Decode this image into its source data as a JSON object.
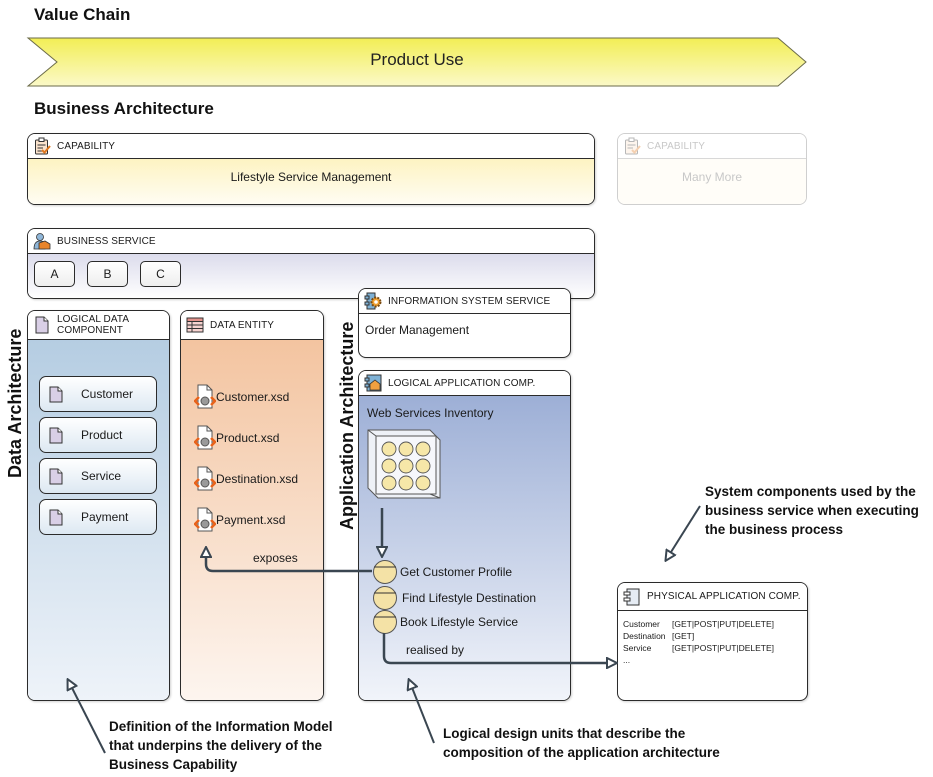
{
  "value_chain": {
    "title": "Value Chain",
    "stage_label": "Product Use"
  },
  "business_architecture": {
    "title": "Business Architecture",
    "capability": {
      "header": "CAPABILITY",
      "icon": "clipboard-check-icon",
      "name": "Lifestyle Service Management"
    },
    "capability_more": {
      "header": "CAPABILITY",
      "icon": "clipboard-check-icon",
      "name": "Many More"
    },
    "business_service": {
      "header": "BUSINESS SERVICE",
      "icon": "person-service-icon",
      "items": [
        "A",
        "B",
        "C"
      ]
    }
  },
  "data_architecture": {
    "title": "Data Architecture",
    "logical_data_component": {
      "header_line1": "LOGICAL DATA",
      "header_line2": "COMPONENT",
      "icon": "document-icon",
      "entities": [
        "Customer",
        "Product",
        "Service",
        "Payment"
      ]
    },
    "data_entity": {
      "header": "DATA ENTITY",
      "icon": "table-icon",
      "files": [
        "Customer.xsd",
        "Product.xsd",
        "Destination.xsd",
        "Payment.xsd"
      ],
      "file_icon": "xml-schema-icon"
    }
  },
  "application_architecture": {
    "title": "Application Architecture",
    "information_system_service": {
      "header": "INFORMATION SYSTEM SERVICE",
      "icon": "component-gear-icon",
      "name": "Order Management"
    },
    "logical_application_component": {
      "header": "LOGICAL APPLICATION COMP.",
      "icon": "component-app-icon",
      "name": "Web Services Inventory",
      "inventory_icon": "service-grid-icon",
      "services": [
        "Get Customer Profile",
        "Find Lifestyle Destination",
        "Book Lifestyle Service"
      ]
    },
    "physical_application_component": {
      "header": "PHYSICAL APPLICATION COMP.",
      "icon": "component-icon",
      "rows": [
        {
          "resource": "Customer",
          "methods": "[GET|POST|PUT|DELETE]"
        },
        {
          "resource": "Destination",
          "methods": "[GET]"
        },
        {
          "resource": "Service",
          "methods": "[GET|POST|PUT|DELETE]"
        },
        {
          "resource": "...",
          "methods": ""
        }
      ]
    }
  },
  "connectors": {
    "exposes": "exposes",
    "realised_by": "realised by"
  },
  "annotations": {
    "system_components": [
      "System components used by the",
      "business service when executing",
      "the business process"
    ],
    "information_model": [
      "Definition of the Information Model",
      "that underpins the delivery of the",
      "Business Capability"
    ],
    "logical_design": [
      "Logical design units that describe the",
      "composition of the application architecture"
    ]
  },
  "colors": {
    "chevron_fill": "#f3f068",
    "capability_fill": "#fdf6cf",
    "business_service_fill": "#e3e3f0",
    "logical_data_fill": "#b6cde2",
    "data_entity_fill": "#f4c9a6",
    "logical_app_fill": "#9eb0d6",
    "connector": "#3a4651"
  }
}
